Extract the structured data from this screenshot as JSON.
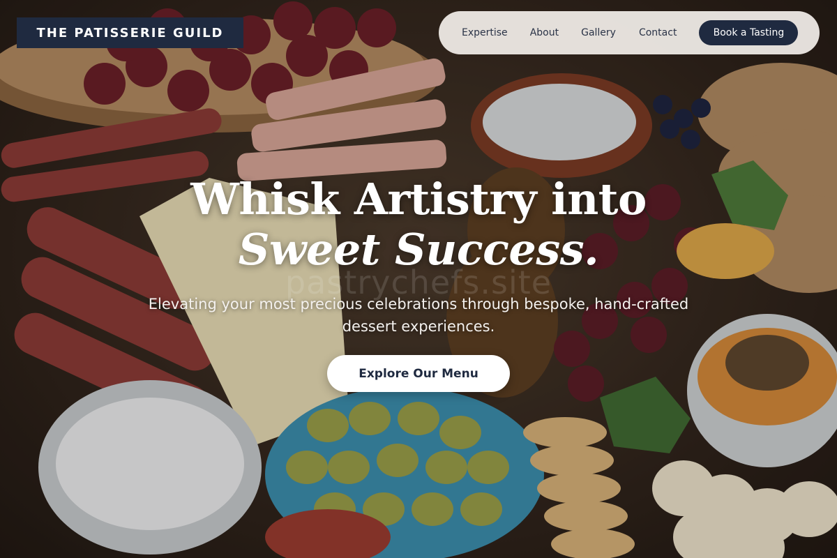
{
  "brand": {
    "logo_text": "THE PATISSERIE GUILD"
  },
  "nav": {
    "links": [
      {
        "label": "Expertise"
      },
      {
        "label": "About"
      },
      {
        "label": "Gallery"
      },
      {
        "label": "Contact"
      }
    ],
    "cta_label": "Book a Tasting"
  },
  "hero": {
    "title_line1": "Whisk Artistry into",
    "title_line2": "Sweet Success.",
    "watermark": "pastrychefs.site",
    "subtitle": "Elevating your most precious celebrations through bespoke, hand-crafted dessert experiences.",
    "button_label": "Explore Our Menu",
    "background_image": "charcuterie-board-photo"
  },
  "colors": {
    "navy": "#1f2a40",
    "nav_bg": "#f2eeea",
    "white": "#ffffff"
  }
}
